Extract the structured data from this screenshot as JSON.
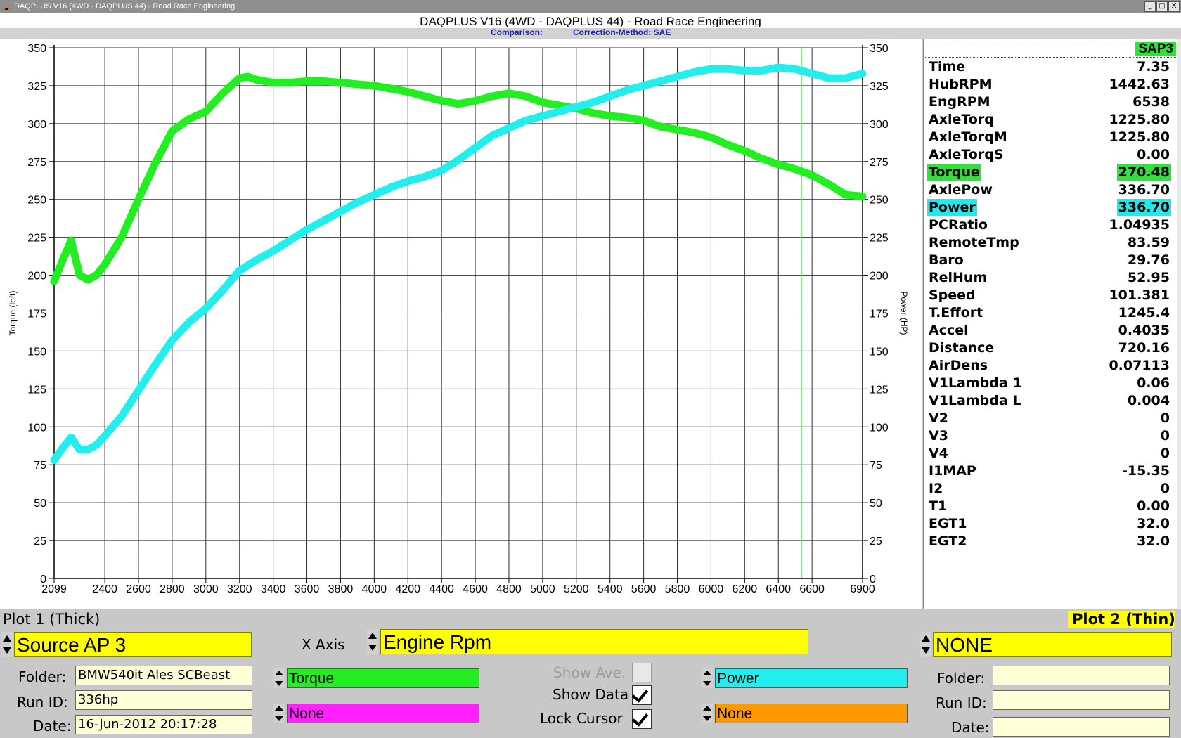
{
  "window": {
    "title": "DAQPLUS V16 (4WD - DAQPLUS 44) - Road Race Engineering",
    "buttons": [
      "_",
      "□",
      "X"
    ]
  },
  "header": {
    "title": "DAQPLUS V16 (4WD - DAQPLUS 44) - Road Race Engineering",
    "comparison_label": "Comparison:",
    "correction_label": "Correction-Method: SAE"
  },
  "chart_data": {
    "type": "line",
    "xlabel": "",
    "ylabel_left": "Torque (lbft)",
    "ylabel_right": "Power (HP)",
    "xlim": [
      2099,
      6900
    ],
    "ylim": [
      0,
      350
    ],
    "x_ticks": [
      "2099",
      "2400",
      "2600",
      "2800",
      "3000",
      "3200",
      "3400",
      "3600",
      "3800",
      "4000",
      "4200",
      "4400",
      "4600",
      "4800",
      "5000",
      "5200",
      "5400",
      "5600",
      "5800",
      "6000",
      "6200",
      "6400",
      "6600",
      "6900"
    ],
    "y_ticks": [
      0,
      25,
      50,
      75,
      100,
      125,
      150,
      175,
      200,
      225,
      250,
      275,
      300,
      325,
      350
    ],
    "grid": true,
    "cursor_x": 6538,
    "series": [
      {
        "name": "Torque",
        "color": "#22ee22",
        "x": [
          2099,
          2150,
          2200,
          2250,
          2300,
          2350,
          2400,
          2500,
          2600,
          2700,
          2800,
          2900,
          3000,
          3100,
          3200,
          3250,
          3300,
          3400,
          3500,
          3600,
          3700,
          3800,
          3900,
          4000,
          4100,
          4200,
          4300,
          4400,
          4500,
          4600,
          4700,
          4800,
          4900,
          5000,
          5100,
          5200,
          5300,
          5400,
          5500,
          5600,
          5700,
          5800,
          5900,
          6000,
          6100,
          6200,
          6300,
          6400,
          6500,
          6600,
          6700,
          6800,
          6900
        ],
        "values": [
          196,
          210,
          223,
          200,
          197,
          200,
          207,
          225,
          250,
          274,
          295,
          303,
          308,
          320,
          330,
          331,
          329,
          327,
          327,
          328,
          328,
          327,
          326,
          325,
          323,
          321,
          318,
          315,
          313,
          315,
          318,
          320,
          318,
          314,
          312,
          310,
          307,
          305,
          304,
          302,
          298,
          296,
          294,
          291,
          286,
          282,
          277,
          273,
          270,
          266,
          260,
          253,
          252
        ]
      },
      {
        "name": "Power",
        "color": "#22eeee",
        "x": [
          2099,
          2150,
          2200,
          2250,
          2300,
          2350,
          2400,
          2500,
          2600,
          2700,
          2800,
          2900,
          3000,
          3100,
          3200,
          3300,
          3400,
          3500,
          3600,
          3700,
          3800,
          3900,
          4000,
          4100,
          4200,
          4300,
          4400,
          4500,
          4600,
          4700,
          4800,
          4900,
          5000,
          5100,
          5200,
          5300,
          5400,
          5500,
          5600,
          5700,
          5800,
          5900,
          6000,
          6100,
          6200,
          6300,
          6400,
          6500,
          6600,
          6700,
          6800,
          6900
        ],
        "values": [
          78,
          86,
          93,
          85,
          85,
          88,
          94,
          107,
          124,
          141,
          157,
          169,
          178,
          190,
          203,
          210,
          216,
          223,
          230,
          236,
          242,
          248,
          253,
          258,
          262,
          265,
          269,
          276,
          284,
          292,
          297,
          302,
          305,
          308,
          311,
          314,
          318,
          322,
          325,
          328,
          331,
          334,
          336,
          336,
          335,
          335,
          337,
          336,
          333,
          330,
          330,
          333
        ]
      }
    ]
  },
  "panel": {
    "source": "SAP3",
    "rows": [
      {
        "name": "Time",
        "value": "7.35"
      },
      {
        "name": "HubRPM",
        "value": "1442.63"
      },
      {
        "name": "EngRPM",
        "value": "6538"
      },
      {
        "name": "AxleTorq",
        "value": "1225.80"
      },
      {
        "name": "AxleTorqM",
        "value": "1225.80"
      },
      {
        "name": "AxleTorqS",
        "value": "0.00"
      },
      {
        "name": "Torque",
        "value": "270.48",
        "highlight": "#2fe13a"
      },
      {
        "name": "AxlePow",
        "value": "336.70"
      },
      {
        "name": "Power",
        "value": "336.70",
        "highlight": "#22e8ee"
      },
      {
        "name": "PCRatio",
        "value": "1.04935"
      },
      {
        "name": "RemoteTmp",
        "value": "83.59"
      },
      {
        "name": "Baro",
        "value": "29.76"
      },
      {
        "name": "RelHum",
        "value": "52.95"
      },
      {
        "name": "Speed",
        "value": "101.381"
      },
      {
        "name": "T.Effort",
        "value": "1245.4"
      },
      {
        "name": "Accel",
        "value": "0.4035"
      },
      {
        "name": "Distance",
        "value": "720.16"
      },
      {
        "name": "AirDens",
        "value": "0.07113"
      },
      {
        "name": "V1Lambda 1",
        "value": "0.06"
      },
      {
        "name": "V1Lambda L",
        "value": "0.004"
      },
      {
        "name": "V2",
        "value": "0"
      },
      {
        "name": "V3",
        "value": "0"
      },
      {
        "name": "V4",
        "value": "0"
      },
      {
        "name": "I1MAP",
        "value": "-15.35"
      },
      {
        "name": "I2",
        "value": "0"
      },
      {
        "name": "T1",
        "value": "0.00"
      },
      {
        "name": "EGT1",
        "value": "32.0"
      },
      {
        "name": "EGT2",
        "value": "32.0"
      }
    ]
  },
  "controls": {
    "plot1_label": "Plot 1 (Thick)",
    "plot2_label": "Plot 2 (Thin)",
    "source": "Source AP 3",
    "plot2_source": "NONE",
    "xaxis_label": "X Axis",
    "xaxis_value": "Engine Rpm",
    "folder_label": "Folder:",
    "runid_label": "Run ID:",
    "date_label": "Date:",
    "folder": "BMW540it Ales SCBeast",
    "runid": "336hp",
    "date": "16-Jun-2012  20:17:28",
    "plot2_folder": "",
    "plot2_runid": "",
    "plot2_date": "",
    "channel1": "Torque",
    "channel2": "None",
    "channel3": "Power",
    "channel4": "None",
    "show_ave": "Show Ave.",
    "show_data": "Show Data",
    "lock_cursor": "Lock Cursor",
    "colors": {
      "torque": "#22ee22",
      "power": "#22eeee",
      "magenta": "#ff22ff",
      "orange": "#ff9900",
      "yellow": "#ffff00"
    }
  }
}
